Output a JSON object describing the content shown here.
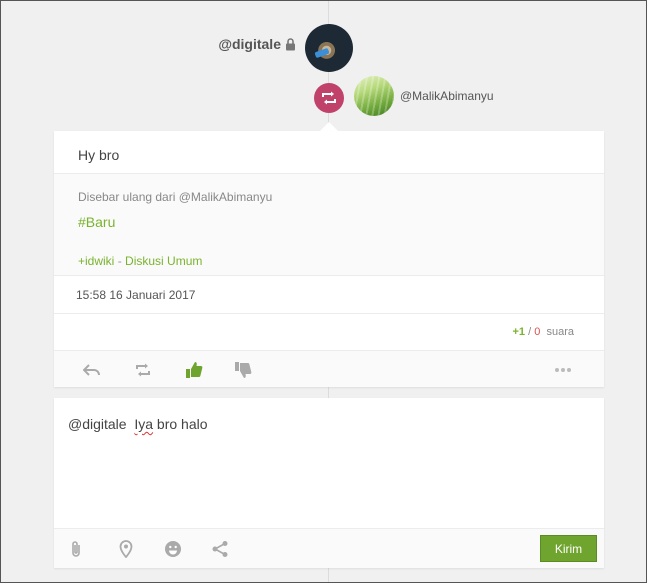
{
  "post": {
    "author": "@digitale",
    "reshared_by": "@MalikAbimanyu",
    "text": "Hy bro",
    "shared": {
      "from_label": "Disebar ulang dari @MalikAbimanyu",
      "hashtag": "#Baru",
      "community_tag": "+idwiki",
      "community_sep": " - ",
      "community_name": "Diskusi Umum"
    },
    "timestamp": "15:58 16 Januari 2017",
    "votes": {
      "plus": "+1",
      "sep": " / ",
      "minus": "0",
      "label": "suara"
    },
    "actions": [
      {
        "name": "reply-icon"
      },
      {
        "name": "reshare-icon"
      },
      {
        "name": "thumbs-up-icon",
        "active": true
      },
      {
        "name": "thumbs-down-icon"
      },
      {
        "name": "more-icon"
      }
    ]
  },
  "comment": {
    "mention": "@digitale",
    "spacing": "  ",
    "word1": "Iya",
    "rest": " bro halo",
    "tools": [
      "attach-icon",
      "location-icon",
      "emoji-icon",
      "share-icon"
    ],
    "send_label": "Kirim"
  },
  "colors": {
    "accent_green": "#7ab32e",
    "reshare_badge": "#c0416a",
    "send_button": "#6fa52f"
  }
}
